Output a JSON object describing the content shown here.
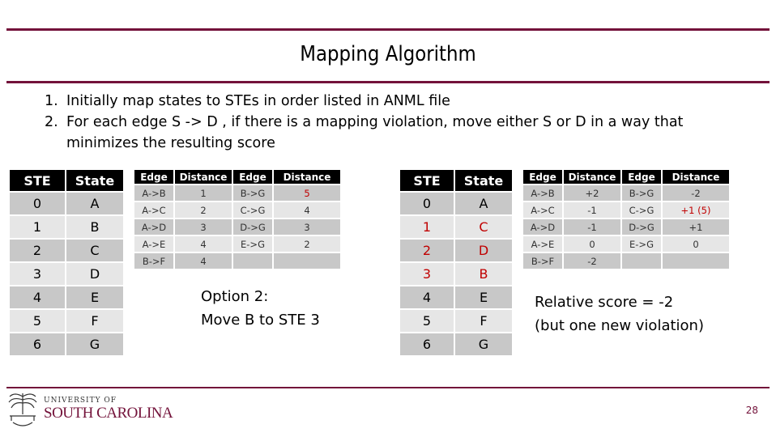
{
  "slide": {
    "title": "Mapping Algorithm",
    "bullets": [
      {
        "num": "1.",
        "text": "Initially map states to STEs in order listed in ANML file"
      },
      {
        "num": "2.",
        "text": "For each edge S -> D , if there is a mapping violation, move either S or D in a way that minimizes the resulting score"
      }
    ],
    "accent_color": "#73123a",
    "highlight_color": "#c00000",
    "page_number": "28",
    "logo": {
      "line1": "UNIVERSITY OF",
      "line2": "SOUTH CAROLINA"
    }
  },
  "left": {
    "ste_table": {
      "headers": [
        "STE",
        "State"
      ],
      "rows": [
        {
          "ste": "0",
          "state": "A",
          "highlight": false
        },
        {
          "ste": "1",
          "state": "B",
          "highlight": false
        },
        {
          "ste": "2",
          "state": "C",
          "highlight": false
        },
        {
          "ste": "3",
          "state": "D",
          "highlight": false
        },
        {
          "ste": "4",
          "state": "E",
          "highlight": false
        },
        {
          "ste": "5",
          "state": "F",
          "highlight": false
        },
        {
          "ste": "6",
          "state": "G",
          "highlight": false
        }
      ]
    },
    "edge_table": {
      "headers": [
        "Edge",
        "Distance",
        "Edge",
        "Distance"
      ],
      "rows": [
        {
          "e1": "A->B",
          "d1": "1",
          "e2": "B->G",
          "d2": "5",
          "d2_highlight": true
        },
        {
          "e1": "A->C",
          "d1": "2",
          "e2": "C->G",
          "d2": "4",
          "d2_highlight": false
        },
        {
          "e1": "A->D",
          "d1": "3",
          "e2": "D->G",
          "d2": "3",
          "d2_highlight": false
        },
        {
          "e1": "A->E",
          "d1": "4",
          "e2": "E->G",
          "d2": "2",
          "d2_highlight": false
        },
        {
          "e1": "B->F",
          "d1": "4",
          "e2": "",
          "d2": "",
          "d2_highlight": false
        }
      ]
    },
    "note": [
      "Option 2:",
      "Move B to STE 3"
    ]
  },
  "right": {
    "ste_table": {
      "headers": [
        "STE",
        "State"
      ],
      "rows": [
        {
          "ste": "0",
          "state": "A",
          "highlight": false
        },
        {
          "ste": "1",
          "state": "C",
          "highlight": true
        },
        {
          "ste": "2",
          "state": "D",
          "highlight": true
        },
        {
          "ste": "3",
          "state": "B",
          "highlight": true
        },
        {
          "ste": "4",
          "state": "E",
          "highlight": false
        },
        {
          "ste": "5",
          "state": "F",
          "highlight": false
        },
        {
          "ste": "6",
          "state": "G",
          "highlight": false
        }
      ]
    },
    "edge_table": {
      "headers": [
        "Edge",
        "Distance",
        "Edge",
        "Distance"
      ],
      "rows": [
        {
          "e1": "A->B",
          "d1": "+2",
          "e2": "B->G",
          "d2": "-2",
          "d2_highlight": false
        },
        {
          "e1": "A->C",
          "d1": "-1",
          "e2": "C->G",
          "d2": "+1 (5)",
          "d2_highlight": true
        },
        {
          "e1": "A->D",
          "d1": "-1",
          "e2": "D->G",
          "d2": "+1",
          "d2_highlight": false
        },
        {
          "e1": "A->E",
          "d1": "0",
          "e2": "E->G",
          "d2": "0",
          "d2_highlight": false
        },
        {
          "e1": "B->F",
          "d1": "-2",
          "e2": "",
          "d2": "",
          "d2_highlight": false
        }
      ]
    },
    "note": [
      "Relative score = -2",
      "(but one new violation)"
    ]
  }
}
